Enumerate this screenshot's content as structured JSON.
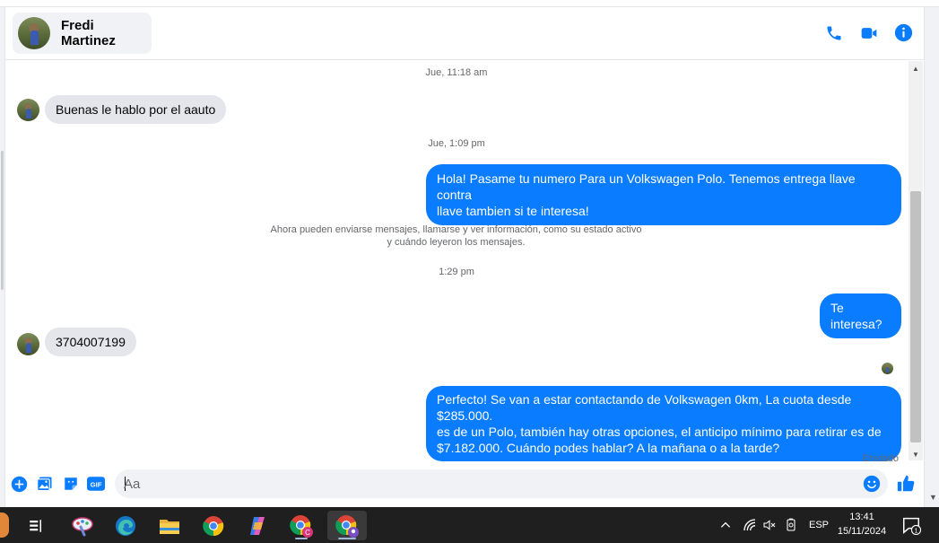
{
  "contact": {
    "name": "Fredi Martinez"
  },
  "header_icons": [
    "phone-icon",
    "video-camera-icon",
    "info-icon"
  ],
  "conversation": {
    "timestamps": [
      "Jue, 11:18 am",
      "Jue, 1:09 pm",
      "1:29 pm"
    ],
    "messages": [
      {
        "direction": "in",
        "text": "Buenas le hablo por el aauto"
      },
      {
        "direction": "out",
        "line1": "Hola! Pasame tu numero Para un Volkswagen Polo. Tenemos entrega llave contra",
        "line2": "llave tambien si te interesa!"
      },
      {
        "direction": "out",
        "text": "Te interesa?"
      },
      {
        "direction": "in",
        "text": "3704007199"
      },
      {
        "direction": "out",
        "line1": "Perfecto!  Se van a estar contactando de Volkswagen 0km, La cuota desde $285.000.",
        "line2": "es de un Polo, también hay otras opciones, el anticipo mínimo para retirar es de",
        "line3": "$7.182.000. Cuándo podes hablar? A la mañana o a la tarde?"
      }
    ],
    "system_notice": {
      "line1": "Ahora pueden enviarse mensajes, llamarse y ver información, como su estado activo",
      "line2": "y cuándo leyeron los mensajes."
    },
    "status": "Enviado"
  },
  "composer": {
    "placeholder": "Aa",
    "value": "",
    "icons": [
      "plus-circle-icon",
      "photo-icon",
      "sticker-icon",
      "gif-icon",
      "emoji-icon",
      "thumbs-up-icon"
    ],
    "gif_label": "GIF"
  },
  "taskbar": {
    "apps": [
      "task-view-icon",
      "paint-icon",
      "edge-icon",
      "file-explorer-icon",
      "chrome-icon",
      "copilot-icon",
      "chrome-profile-c-icon",
      "chrome-profile-active-icon"
    ],
    "tray": {
      "language": "ESP",
      "time": "13:41",
      "date": "15/11/2024",
      "notifications": "1"
    }
  },
  "colors": {
    "accent": "#0a7cff",
    "incoming_bubble": "#e4e6eb",
    "taskbar": "#1f1f1f"
  }
}
